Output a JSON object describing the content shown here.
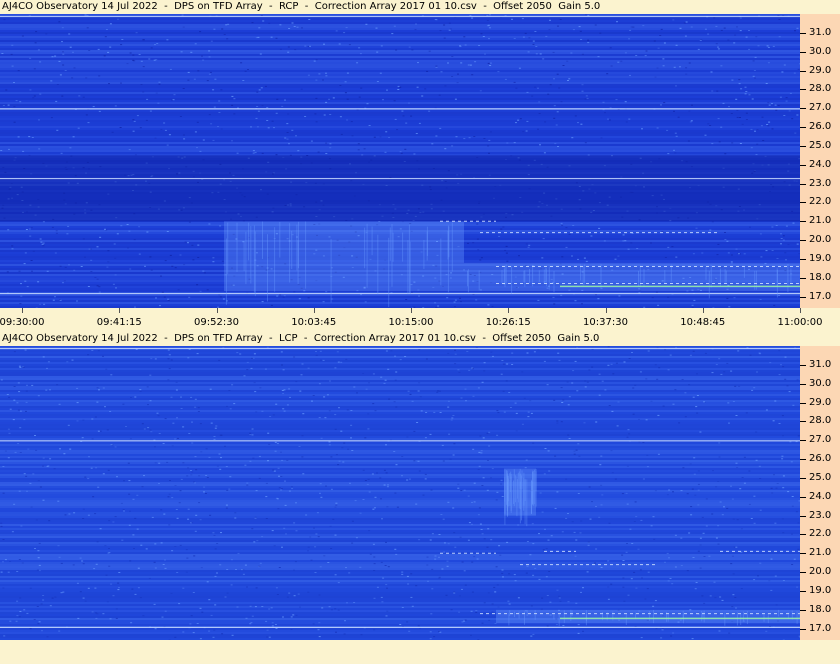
{
  "chart_data": [
    {
      "type": "heatmap",
      "title": "AJ4CO Observatory 14 Jul 2022  -  DPS on TFD Array  -  RCP  -  Correction Array 2017 01 10.csv  -  Offset 2050  Gain 5.0",
      "ylim": [
        16.4,
        32.0
      ],
      "yticks": [
        "17.0",
        "18.0",
        "19.0",
        "20.0",
        "21.0",
        "22.0",
        "23.0",
        "24.0",
        "25.0",
        "26.0",
        "27.0",
        "28.0",
        "29.0",
        "30.0",
        "31.0"
      ],
      "yvalues": [
        17,
        18,
        19,
        20,
        21,
        22,
        23,
        24,
        25,
        26,
        27,
        28,
        29,
        30,
        31
      ],
      "xticks": [
        "09:30:00",
        "09:41:15",
        "09:52:30",
        "10:03:45",
        "10:15:00",
        "10:26:15",
        "10:37:30",
        "10:48:45",
        "11:00:00"
      ],
      "colors": {
        "background": "#1d3fd8",
        "deep": "#0f23a8",
        "bright": "#6a9cff",
        "line": "#c9dcff",
        "hot": "#9cf6a6"
      },
      "features": [
        {
          "kind": "band-dark",
          "from": 21.0,
          "to": 24.5
        },
        {
          "kind": "line",
          "at": 27.0
        },
        {
          "kind": "line",
          "at": 23.3
        },
        {
          "kind": "line",
          "at": 17.2
        },
        {
          "kind": "line",
          "at": 31.9
        },
        {
          "kind": "burst",
          "t0": 0.28,
          "t1": 0.58,
          "f0": 17.3,
          "f1": 21.0
        },
        {
          "kind": "burst",
          "t0": 0.58,
          "t1": 1.0,
          "f0": 17.3,
          "f1": 18.8
        }
      ]
    },
    {
      "type": "heatmap",
      "title": "AJ4CO Observatory 14 Jul 2022  -  DPS on TFD Array  -  LCP  -  Correction Array 2017 01 10.csv  -  Offset 2050  Gain 5.0",
      "ylim": [
        16.4,
        32.0
      ],
      "yticks": [
        "17.0",
        "18.0",
        "19.0",
        "20.0",
        "21.0",
        "22.0",
        "23.0",
        "24.0",
        "25.0",
        "26.0",
        "27.0",
        "28.0",
        "29.0",
        "30.0",
        "31.0"
      ],
      "yvalues": [
        17,
        18,
        19,
        20,
        21,
        22,
        23,
        24,
        25,
        26,
        27,
        28,
        29,
        30,
        31
      ],
      "colors": {
        "background": "#2149dd",
        "deep": "#1431b8",
        "bright": "#6a9cff",
        "line": "#c9dcff",
        "hot": "#9cf6a6"
      },
      "features": [
        {
          "kind": "line",
          "at": 27.0
        },
        {
          "kind": "line",
          "at": 17.1
        },
        {
          "kind": "line",
          "at": 31.9
        },
        {
          "kind": "burst",
          "t0": 0.63,
          "t1": 0.67,
          "f0": 23.0,
          "f1": 25.5
        },
        {
          "kind": "burst",
          "t0": 0.62,
          "t1": 1.0,
          "f0": 17.3,
          "f1": 18.0
        }
      ]
    }
  ]
}
